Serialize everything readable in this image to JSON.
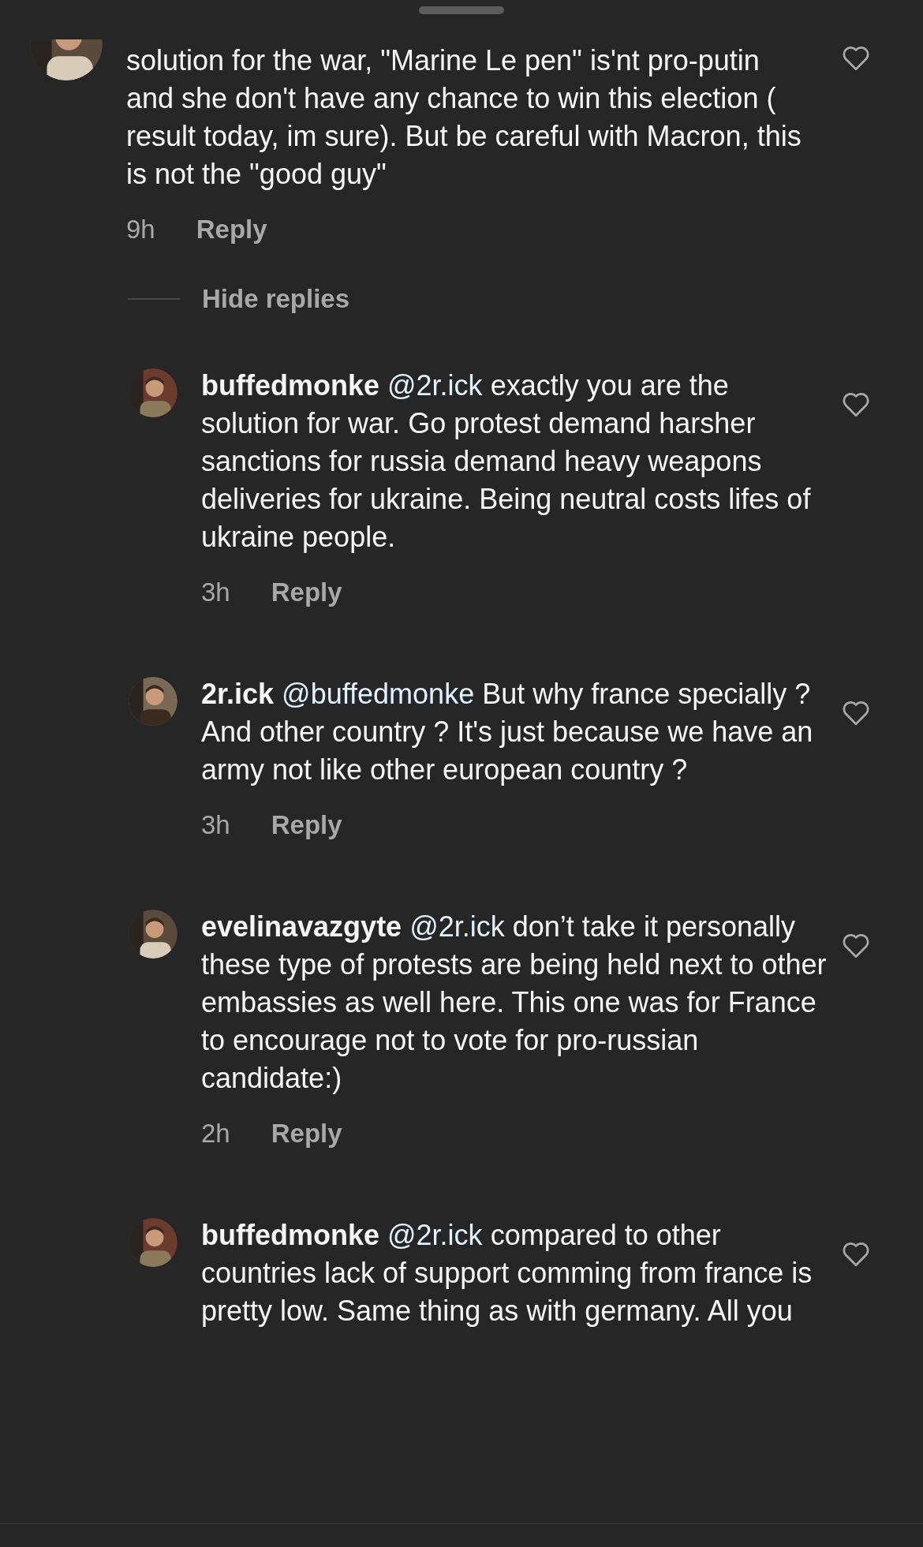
{
  "top_comment": {
    "text": "solution for the war, \"Marine Le pen\" is'nt pro-putin and she don't have any chance to win this election ( result today, im sure). But be careful with Macron, this is not the \"good guy\"",
    "time": "9h",
    "reply_label": "Reply"
  },
  "hide_replies": "Hide replies",
  "replies": [
    {
      "username": "buffedmonke",
      "mention": "@2r.ick",
      "text": "exactly you are the solution for war. Go protest demand harsher sanctions for russia demand heavy weapons deliveries for ukraine. Being neutral costs lifes of ukraine people.",
      "time": "3h",
      "reply_label": "Reply"
    },
    {
      "username": "2r.ick",
      "mention": "@buffedmonke",
      "text": "But why france specially ? And other country ? It's just because we have an army not like other european country ?",
      "time": "3h",
      "reply_label": "Reply"
    },
    {
      "username": "evelinavazgyte",
      "mention": "@2r.ick",
      "text": "don’t take it personally these type of protests are being held next to other embassies as well here. This one was for France to encourage not to vote for pro-russian candidate:)",
      "time": "2h",
      "reply_label": "Reply"
    },
    {
      "username": "buffedmonke",
      "mention": "@2r.ick",
      "text": "compared to other countries lack of support comming from france is pretty low. Same thing as with germany. All you"
    }
  ]
}
